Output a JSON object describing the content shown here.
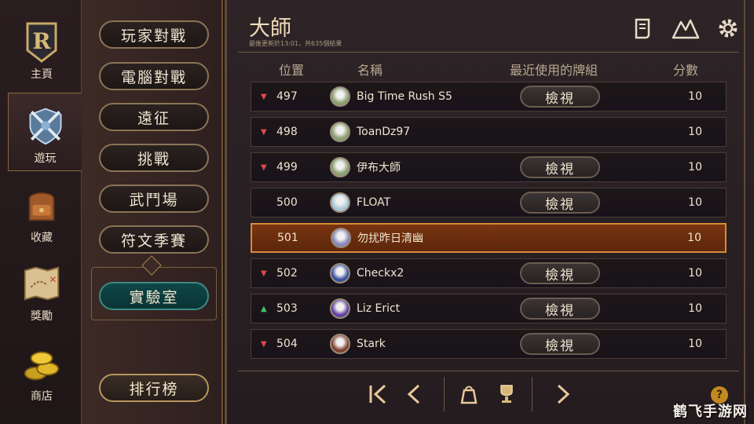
{
  "rail": {
    "items": [
      {
        "label": "主頁",
        "icon": "legends-of-runeterra-logo-icon"
      },
      {
        "label": "遊玩",
        "icon": "crossed-swords-shield-icon"
      },
      {
        "label": "收藏",
        "icon": "backpack-icon"
      },
      {
        "label": "獎勵",
        "icon": "treasure-map-icon"
      },
      {
        "label": "商店",
        "icon": "gold-coins-icon"
      }
    ]
  },
  "submenu": {
    "items": [
      "玩家對戰",
      "電腦對戰",
      "遠征",
      "挑戰",
      "武鬥場",
      "符文季賽"
    ],
    "lab": "實驗室",
    "leaderboard": "排行榜"
  },
  "main": {
    "title": "大師",
    "subtitle": "最後更新於13:01，共635個結果",
    "columns": {
      "position": "位置",
      "name": "名稱",
      "deck": "最近使用的牌組",
      "score": "分數"
    },
    "rows": [
      {
        "trend": "down",
        "position": "497",
        "name": "Big Time Rush S5",
        "view": "檢視",
        "score": "10",
        "highlight": false
      },
      {
        "trend": "down",
        "position": "498",
        "name": "ToanDz97",
        "view": "",
        "score": "10",
        "highlight": false
      },
      {
        "trend": "down",
        "position": "499",
        "name": "伊布大師",
        "view": "檢視",
        "score": "10",
        "highlight": false
      },
      {
        "trend": "none",
        "position": "500",
        "name": "FLOAT",
        "view": "檢視",
        "score": "10",
        "highlight": false
      },
      {
        "trend": "none",
        "position": "501",
        "name": "勿扰昨日清幽",
        "view": "",
        "score": "10",
        "highlight": true
      },
      {
        "trend": "down",
        "position": "502",
        "name": "Checkx2",
        "view": "檢視",
        "score": "10",
        "highlight": false
      },
      {
        "trend": "up",
        "position": "503",
        "name": "Liz Erict",
        "view": "檢視",
        "score": "10",
        "highlight": false
      },
      {
        "trend": "down",
        "position": "504",
        "name": "Stark",
        "view": "檢視",
        "score": "10",
        "highlight": false
      }
    ],
    "help": "?"
  },
  "watermark": "鹤飞手游网",
  "colors": {
    "accent": "#d88a3a",
    "highlight_row": "#7a3410",
    "lab_teal": "#0f4747",
    "down": "#e04848",
    "up": "#44c464",
    "gold": "#c48a20"
  }
}
